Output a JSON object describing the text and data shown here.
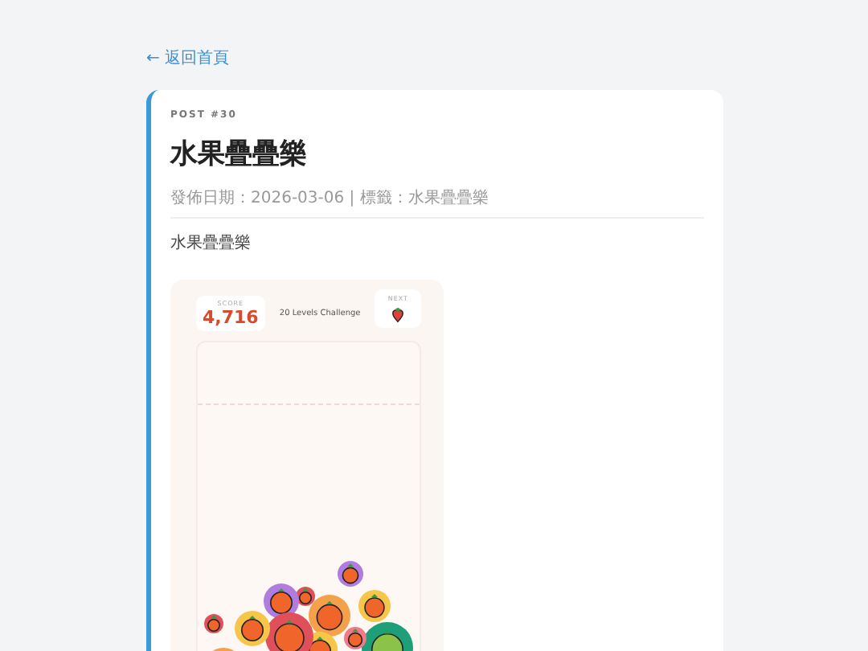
{
  "back_link": "← 返回首頁",
  "post": {
    "number": "POST #30",
    "title": "水果疊疊樂",
    "meta": "發佈日期：2026-03-06 | 標籤：水果疊疊樂",
    "body": "水果疊疊樂"
  },
  "game_screenshot": {
    "score_label": "SCORE",
    "score": "4,716",
    "mode": "20 Levels Challenge",
    "next_label": "NEXT"
  }
}
